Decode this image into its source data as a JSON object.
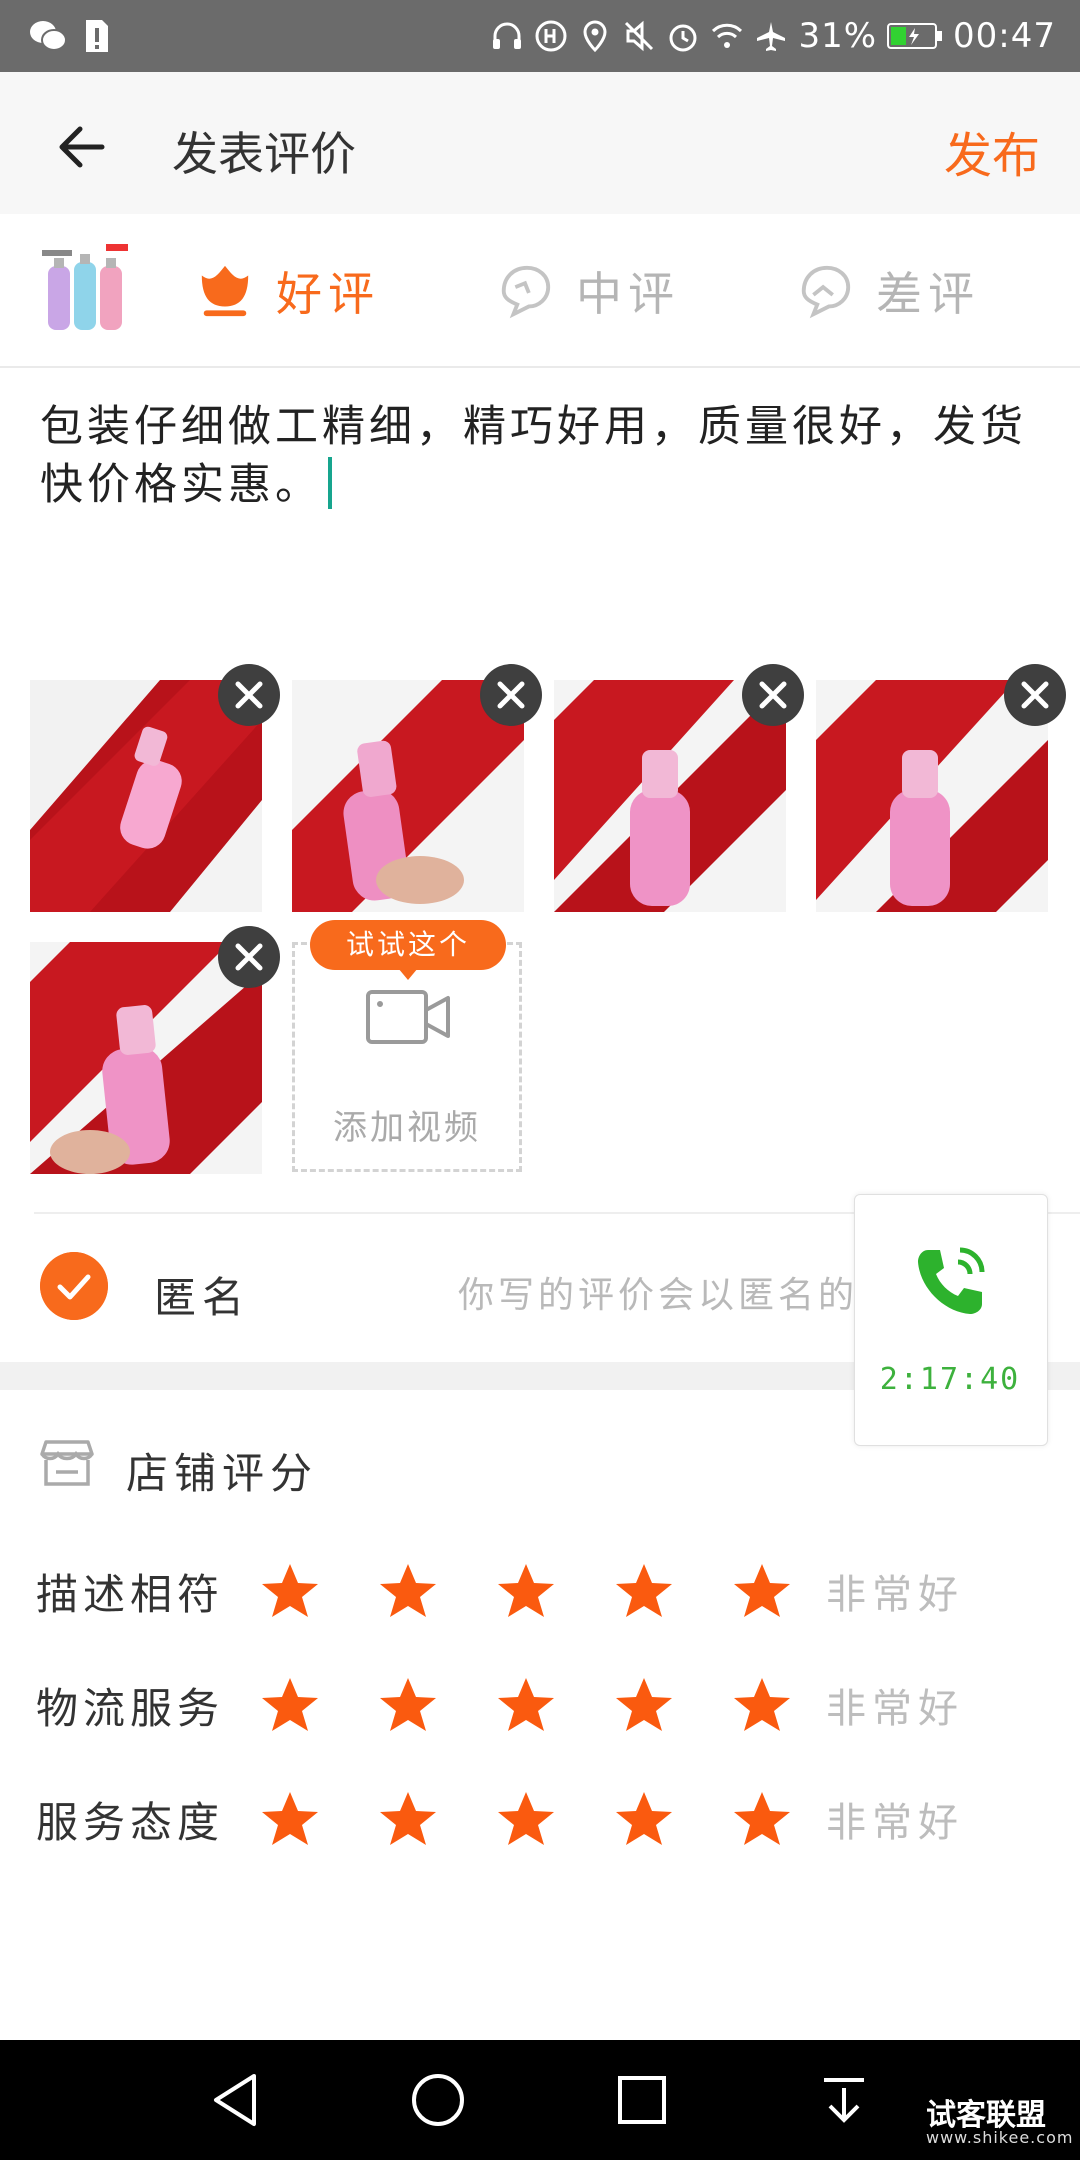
{
  "status_bar": {
    "battery_percent": "31%",
    "time": "00:47",
    "icons": [
      "wechat-icon",
      "sim-alert-icon",
      "headphones-icon",
      "hd-icon",
      "location-icon",
      "mute-icon",
      "alarm-icon",
      "wifi-icon",
      "airplane-icon",
      "battery-icon"
    ]
  },
  "header": {
    "title": "发表评价",
    "publish_label": "发布"
  },
  "rating": {
    "options": [
      {
        "label": "好评",
        "selected": true
      },
      {
        "label": "中评",
        "selected": false
      },
      {
        "label": "差评",
        "selected": false
      }
    ]
  },
  "review": {
    "text": "包装仔细做工精细，精巧好用，质量很好，发货快价格实惠。"
  },
  "media": {
    "photo_count": 5,
    "try_tag": "试试这个",
    "add_video_label": "添加视频"
  },
  "anonymous": {
    "checked": true,
    "label": "匿名",
    "hint": "你写的评价会以匿名的"
  },
  "call_widget": {
    "timer": "2:17:40"
  },
  "shop_rating": {
    "title": "店铺评分",
    "rows": [
      {
        "name": "描述相符",
        "stars": 5,
        "word": "非常好"
      },
      {
        "name": "物流服务",
        "stars": 5,
        "word": "非常好"
      },
      {
        "name": "服务态度",
        "stars": 5,
        "word": "非常好"
      }
    ]
  },
  "watermark": {
    "name": "试客联盟",
    "url": "www.shikee.com"
  },
  "colors": {
    "accent": "#f86a1c",
    "call_green": "#3db13d",
    "status_bar": "#6b6b6b"
  }
}
